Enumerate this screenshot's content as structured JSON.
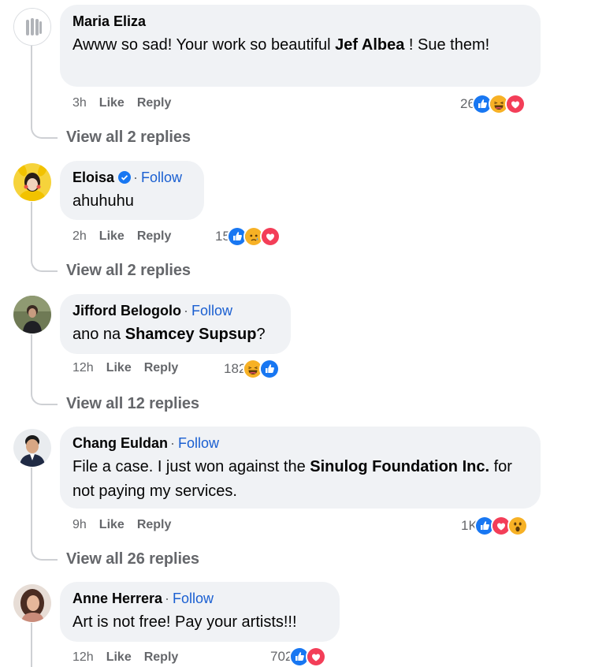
{
  "colors": {
    "accent": "#1877f2",
    "follow": "#1a5fd1",
    "secondary_text": "#65676b",
    "bubble_bg": "#f0f2f5"
  },
  "comments": [
    {
      "name": "Maria Eliza",
      "follow_label": "",
      "text_parts": [
        "Awww so sad! Your work so beautiful ",
        "Jef Albea",
        " ! Sue them!"
      ],
      "time": "3h",
      "like": "Like",
      "reply": "Reply",
      "reaction_count": "26",
      "reactions": [
        "like-icon",
        "haha-icon",
        "love-icon"
      ],
      "view_replies": "View all 2 replies"
    },
    {
      "name": "Eloisa",
      "follow_label": "Follow",
      "text_parts": [
        "ahuhuhu"
      ],
      "time": "2h",
      "like": "Like",
      "reply": "Reply",
      "reaction_count": "15",
      "reactions": [
        "like-icon",
        "sad-icon",
        "love-icon"
      ],
      "view_replies": "View all 2 replies"
    },
    {
      "name": "Jifford Belogolo",
      "follow_label": "Follow",
      "text_parts": [
        "ano na ",
        "Shamcey Supsup",
        "?"
      ],
      "time": "12h",
      "like": "Like",
      "reply": "Reply",
      "reaction_count": "182",
      "reactions": [
        "haha-icon",
        "like-icon"
      ],
      "view_replies": "View all 12 replies"
    },
    {
      "name": "Chang Euldan",
      "follow_label": "Follow",
      "text_parts": [
        "File a case. I just won against the ",
        "Sinulog Foundation Inc.",
        " for not paying my services."
      ],
      "time": "9h",
      "like": "Like",
      "reply": "Reply",
      "reaction_count": "1K",
      "reactions": [
        "like-icon",
        "love-icon",
        "wow-icon"
      ],
      "view_replies": "View all 26 replies"
    },
    {
      "name": "Anne Herrera",
      "follow_label": "Follow",
      "text_parts": [
        "Art is not free! Pay your artists!!!"
      ],
      "time": "12h",
      "like": "Like",
      "reply": "Reply",
      "reaction_count": "702",
      "reactions": [
        "like-icon",
        "love-icon"
      ]
    }
  ]
}
